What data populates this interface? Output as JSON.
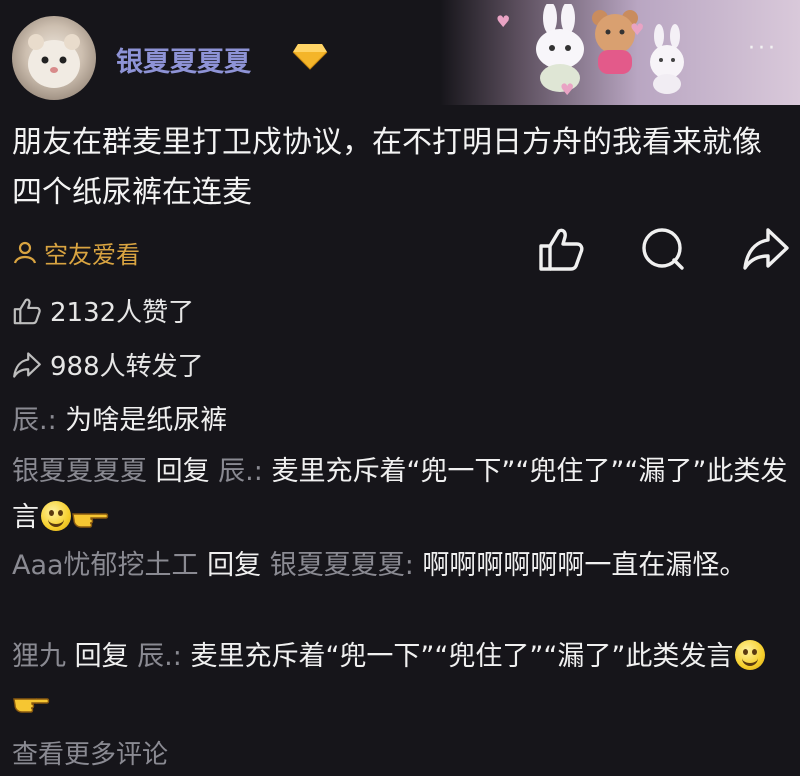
{
  "post": {
    "username": "银夏夏夏夏",
    "text": "朋友在群麦里打卫戍协议，在不打明日方舟的我看来就像四个纸尿裤在连麦",
    "source_label": "空友爱看"
  },
  "stats": {
    "likes": "2132人赞了",
    "shares": "988人转发了"
  },
  "comments": [
    {
      "author": "辰.:",
      "text": " 为啥是纸尿裤"
    },
    {
      "author": "银夏夏夏夏",
      "reply_word": " 回复 ",
      "reply_to": "辰.:",
      "text": " 麦里充斥着“兜一下”“兜住了”“漏了”此类发言"
    },
    {
      "author": "Aaa忧郁挖土工",
      "reply_word": " 回复 ",
      "reply_to": "银夏夏夏夏:",
      "text": " 啊啊啊啊啊啊一直在漏怪。"
    },
    {
      "author": "狸九",
      "reply_word": " 回复 ",
      "reply_to": "辰.:",
      "text": " 麦里充斥着“兜一下”“兜住了”“漏了”此类发言"
    }
  ],
  "view_more": "查看更多评论",
  "icons": {
    "avatar": "hamster-avatar",
    "vip": "diamond-icon",
    "more": "more-dots-icon",
    "like": "thumbs-up-icon",
    "comment": "comment-bubble-icon",
    "share": "share-arrow-icon",
    "source": "friends-icon",
    "emoji": "smile-emoji-icon",
    "hand": "pointing-hand-icon"
  },
  "colors": {
    "background": "#16151a",
    "username": "#8e93d6",
    "source": "#d9a441",
    "muted": "#8a8a92"
  }
}
